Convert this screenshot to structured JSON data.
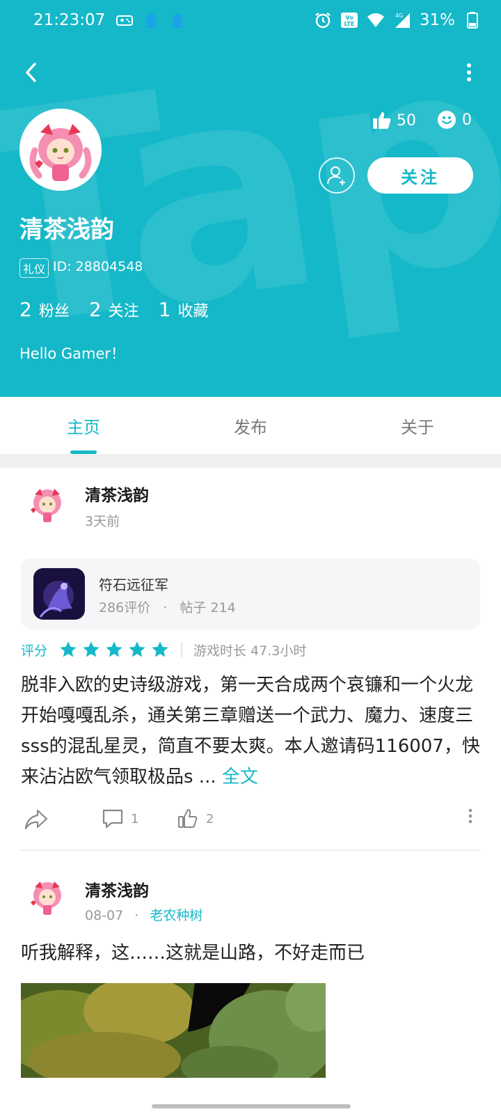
{
  "status_bar": {
    "time": "21:23:07",
    "battery": "31%",
    "network": "4G"
  },
  "header": {
    "watermark": "Tap",
    "likes": "50",
    "smiles": "0",
    "follow_label": "关注",
    "username": "清茶浅韵",
    "badge": "礼仪",
    "user_id": "ID: 28804548",
    "counts": {
      "fans_num": "2",
      "fans_label": "粉丝",
      "following_num": "2",
      "following_label": "关注",
      "favorites_num": "1",
      "favorites_label": "收藏"
    },
    "bio": "Hello Gamer！"
  },
  "tabs": [
    {
      "label": "主页",
      "active": true
    },
    {
      "label": "发布",
      "active": false
    },
    {
      "label": "关于",
      "active": false
    }
  ],
  "posts": [
    {
      "author": "清茶浅韵",
      "time": "3天前",
      "game": {
        "name": "符石远征军",
        "reviews": "286评价",
        "dot": "·",
        "posts": "帖子 214"
      },
      "rating_label": "评分",
      "stars": 5,
      "play_time": "游戏时长 47.3小时",
      "text": "脱非入欧的史诗级游戏，第一天合成两个哀镰和一个火龙开始嘎嘎乱杀，通关第三章赠送一个武力、魔力、速度三sss的混乱星灵，简直不要太爽。本人邀请码116007，快来沾沾欧气领取极品s ... ",
      "read_more": "全文",
      "comments": "1",
      "likes": "2"
    },
    {
      "author": "清茶浅韵",
      "time": "08-07",
      "dot": "·",
      "tag": "老农种树",
      "text": "听我解释，这……这就是山路，不好走而已"
    }
  ],
  "colors": {
    "accent": "#15b8c8",
    "star": "#15b8c8"
  }
}
